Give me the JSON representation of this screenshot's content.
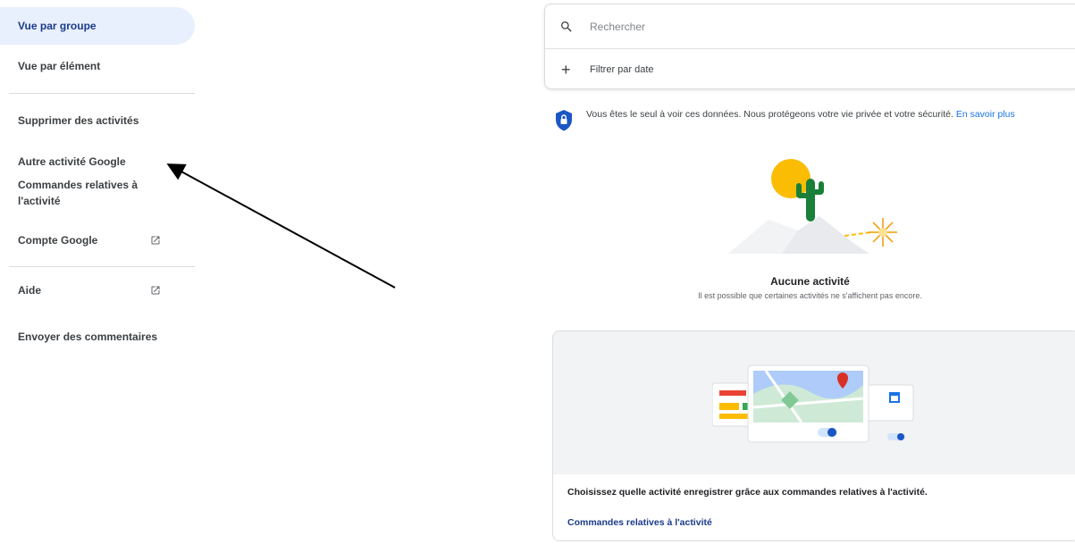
{
  "sidebar": {
    "items": [
      {
        "label": "Vue par groupe"
      },
      {
        "label": "Vue par élément"
      },
      {
        "label": "Supprimer des activités"
      },
      {
        "label": "Autre activité Google"
      },
      {
        "label": "Commandes relatives à l'activité"
      },
      {
        "label": "Compte Google",
        "icon": "open-in-new-icon"
      },
      {
        "label": "Aide",
        "icon": "open-in-new-icon"
      },
      {
        "label": "Envoyer des commentaires"
      }
    ]
  },
  "search": {
    "placeholder": "Rechercher",
    "icon": "search-icon"
  },
  "filter": {
    "label": "Filtrer par date",
    "icon": "plus-icon"
  },
  "privacy": {
    "text": "Vous êtes le seul à voir ces données. Nous protégeons votre vie privée et votre sécurité.",
    "link": "En savoir plus",
    "icon": "shield-lock-icon"
  },
  "empty_state": {
    "title": "Aucune activité",
    "subtitle": "Il est possible que certaines activités ne s'affichent pas encore."
  },
  "promo": {
    "text": "Choisissez quelle activité enregistrer grâce aux commandes relatives à l'activité.",
    "link": "Commandes relatives à l'activité"
  },
  "colors": {
    "accent": "#1a73e8",
    "selected_bg": "#e8f0fe",
    "shield": "#1a56c4"
  }
}
